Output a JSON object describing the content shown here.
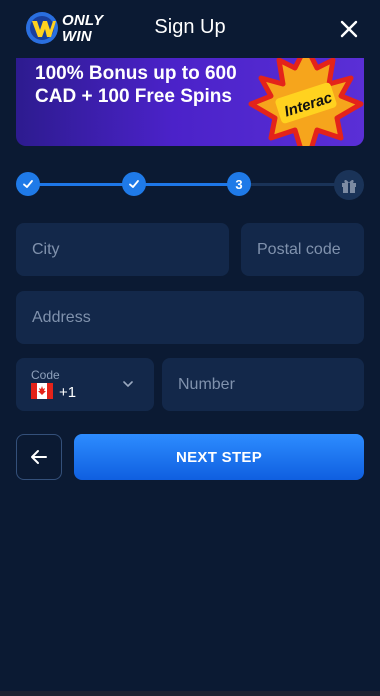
{
  "header": {
    "logo_text_1": "ONLY",
    "logo_text_2": "WIN",
    "title": "Sign Up",
    "close_icon": "close-icon"
  },
  "banner": {
    "promo_text": "100% Bonus up to 600 CAD + 100 Free Spins",
    "badge_text": "Interac",
    "colors": {
      "from": "#2d1b8f",
      "to": "#5a2fd6",
      "leaf": "#f6a51c"
    }
  },
  "stepper": {
    "steps": [
      {
        "state": "done",
        "icon": "check-icon"
      },
      {
        "state": "done",
        "icon": "check-icon"
      },
      {
        "state": "current",
        "label": "3"
      },
      {
        "state": "upcoming",
        "icon": "gift-icon"
      }
    ],
    "accent": "#1f7ae8"
  },
  "form": {
    "city": {
      "placeholder": "City",
      "value": ""
    },
    "postal_code": {
      "placeholder": "Postal code",
      "value": ""
    },
    "address": {
      "placeholder": "Address",
      "value": ""
    },
    "phone_code": {
      "label": "Code",
      "value": "+1",
      "flag": "canada-flag-icon"
    },
    "phone_number": {
      "placeholder": "Number",
      "value": ""
    }
  },
  "actions": {
    "back_icon": "arrow-left-icon",
    "next_label": "NEXT STEP"
  }
}
